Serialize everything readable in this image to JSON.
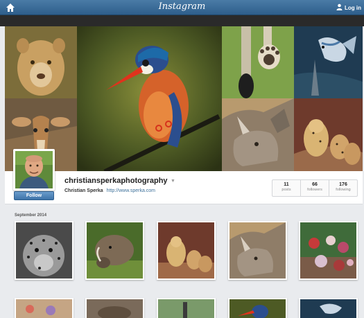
{
  "navbar": {
    "brand": "Instagram",
    "login_label": "Log in",
    "home_icon": "home-icon",
    "user_icon": "person-icon"
  },
  "profile": {
    "username": "christiansperkaphotography",
    "full_name": "Christian Sperka",
    "website": "http://www.sperka.com",
    "follow_label": "Follow",
    "stats": [
      {
        "value": "11",
        "label": "posts"
      },
      {
        "value": "66",
        "label": "followers"
      },
      {
        "value": "176",
        "label": "following"
      }
    ]
  },
  "feed": {
    "month_label": "September 2014",
    "first_row": [
      "leopard",
      "warthog",
      "cheetah-cubs",
      "rhino",
      "birds-market"
    ],
    "second_row": [
      "market",
      "warthog",
      "dragonfly",
      "kingfisher",
      "fish"
    ]
  },
  "colors": {
    "navbar": "#3d6d98",
    "accent_link": "#3f729b",
    "follow_button": "#4e84b8",
    "page_background": "#e9ebee"
  }
}
